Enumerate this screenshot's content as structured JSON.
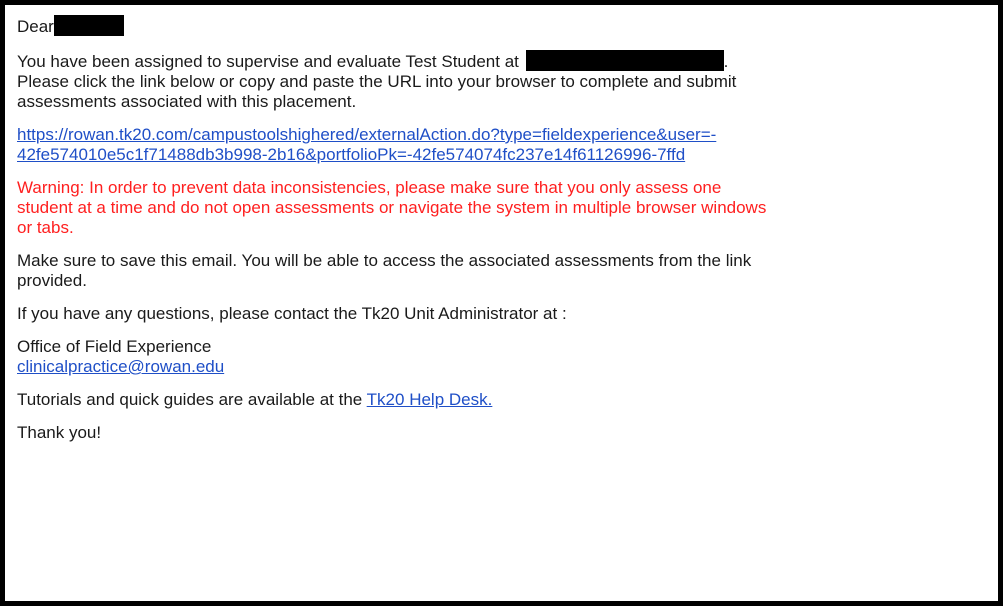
{
  "email": {
    "greeting": "Dear",
    "intro": {
      "line1_before": "You have been assigned to supervise and evaluate Test Student at",
      "line1_after": ".",
      "line2": "Please click the link below or copy and paste the URL into your browser to complete and submit",
      "line3": "assessments associated with this placement."
    },
    "url": {
      "line1": "https://rowan.tk20.com/campustoolshighered/externalAction.do?type=fieldexperience&user=-",
      "line2": "42fe574010e5c1f71488db3b998-2b16&portfolioPk=-42fe574074fc237e14f61126996-7ffd"
    },
    "warning": {
      "line1": "Warning: In order to prevent data inconsistencies, please make sure that you only assess one",
      "line2": "student at a time and do not open assessments or navigate the system in multiple browser windows",
      "line3": "or tabs."
    },
    "save_note": {
      "line1": "Make sure to save this email. You will be able to access the associated assessments from the link",
      "line2": "provided."
    },
    "questions": "If you have any questions, please contact the Tk20 Unit Administrator at :",
    "office": {
      "name": "Office of Field Experience",
      "email": "clinicalpractice@rowan.edu"
    },
    "tutorials": {
      "text": "Tutorials and quick guides are available at the",
      "link": "Tk20 Help Desk."
    },
    "closing": "Thank you!"
  },
  "colors": {
    "link": "#1f4fc7",
    "warning": "#ff1f1f",
    "redaction": "#000000"
  }
}
